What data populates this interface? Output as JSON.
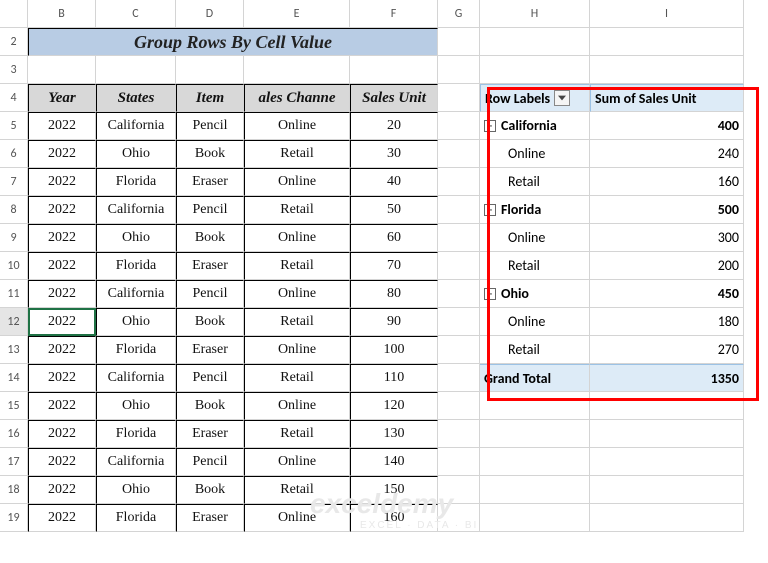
{
  "columns": [
    "B",
    "C",
    "D",
    "E",
    "F",
    "G",
    "H",
    "I"
  ],
  "rows": [
    "2",
    "3",
    "4",
    "5",
    "6",
    "7",
    "8",
    "9",
    "10",
    "11",
    "12",
    "13",
    "14",
    "15",
    "16",
    "17",
    "18",
    "19"
  ],
  "title": "Group Rows By Cell Value",
  "headers": {
    "b": "Year",
    "c": "States",
    "d": "Item",
    "e": "ales Channe",
    "f": "Sales Unit"
  },
  "data": [
    {
      "y": "2022",
      "s": "California",
      "i": "Pencil",
      "c": "Online",
      "u": "20"
    },
    {
      "y": "2022",
      "s": "Ohio",
      "i": "Book",
      "c": "Retail",
      "u": "30"
    },
    {
      "y": "2022",
      "s": "Florida",
      "i": "Eraser",
      "c": "Online",
      "u": "40"
    },
    {
      "y": "2022",
      "s": "California",
      "i": "Pencil",
      "c": "Retail",
      "u": "50"
    },
    {
      "y": "2022",
      "s": "Ohio",
      "i": "Book",
      "c": "Online",
      "u": "60"
    },
    {
      "y": "2022",
      "s": "Florida",
      "i": "Eraser",
      "c": "Retail",
      "u": "70"
    },
    {
      "y": "2022",
      "s": "California",
      "i": "Pencil",
      "c": "Online",
      "u": "80"
    },
    {
      "y": "2022",
      "s": "Ohio",
      "i": "Book",
      "c": "Retail",
      "u": "90"
    },
    {
      "y": "2022",
      "s": "Florida",
      "i": "Eraser",
      "c": "Online",
      "u": "100"
    },
    {
      "y": "2022",
      "s": "California",
      "i": "Pencil",
      "c": "Retail",
      "u": "110"
    },
    {
      "y": "2022",
      "s": "Ohio",
      "i": "Book",
      "c": "Online",
      "u": "120"
    },
    {
      "y": "2022",
      "s": "Florida",
      "i": "Eraser",
      "c": "Retail",
      "u": "130"
    },
    {
      "y": "2022",
      "s": "California",
      "i": "Pencil",
      "c": "Online",
      "u": "140"
    },
    {
      "y": "2022",
      "s": "Ohio",
      "i": "Book",
      "c": "Retail",
      "u": "150"
    },
    {
      "y": "2022",
      "s": "Florida",
      "i": "Eraser",
      "c": "Online",
      "u": "160"
    }
  ],
  "pivot": {
    "hdr1": "Row Labels",
    "hdr2": "Sum of Sales Unit",
    "groups": [
      {
        "name": "California",
        "total": "400",
        "rows": [
          {
            "n": "Online",
            "v": "240"
          },
          {
            "n": "Retail",
            "v": "160"
          }
        ]
      },
      {
        "name": "Florida",
        "total": "500",
        "rows": [
          {
            "n": "Online",
            "v": "300"
          },
          {
            "n": "Retail",
            "v": "200"
          }
        ]
      },
      {
        "name": "Ohio",
        "total": "450",
        "rows": [
          {
            "n": "Online",
            "v": "180"
          },
          {
            "n": "Retail",
            "v": "270"
          }
        ]
      }
    ],
    "gt_label": "Grand Total",
    "gt_value": "1350"
  },
  "watermark": {
    "big": "exceldemy",
    "small": "EXCEL · DATA · BI"
  }
}
